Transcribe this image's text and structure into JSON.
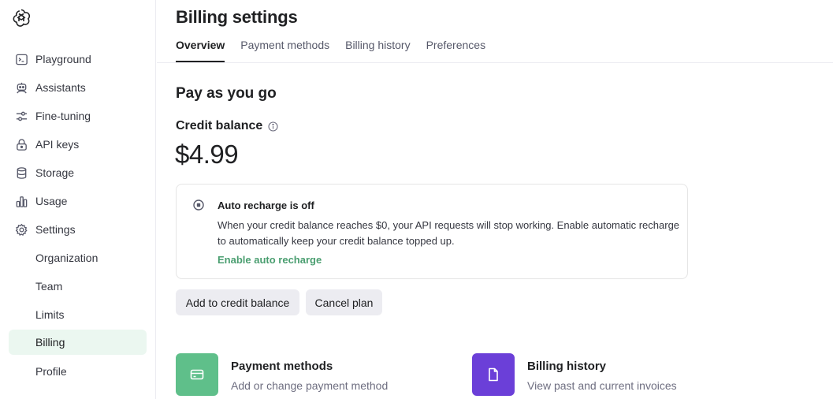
{
  "sidebar": {
    "logo": "openai-logo-icon",
    "items": [
      {
        "label": "Playground",
        "icon": "terminal-icon"
      },
      {
        "label": "Assistants",
        "icon": "robot-icon"
      },
      {
        "label": "Fine-tuning",
        "icon": "sliders-icon"
      },
      {
        "label": "API keys",
        "icon": "lock-icon"
      },
      {
        "label": "Storage",
        "icon": "database-icon"
      },
      {
        "label": "Usage",
        "icon": "bar-chart-icon"
      },
      {
        "label": "Settings",
        "icon": "gear-icon"
      }
    ],
    "settings_sub": [
      {
        "label": "Organization"
      },
      {
        "label": "Team"
      },
      {
        "label": "Limits"
      },
      {
        "label": "Billing",
        "active": true
      },
      {
        "label": "Profile"
      }
    ]
  },
  "header": {
    "title": "Billing settings",
    "tabs": [
      {
        "label": "Overview",
        "active": true
      },
      {
        "label": "Payment methods"
      },
      {
        "label": "Billing history"
      },
      {
        "label": "Preferences"
      }
    ]
  },
  "plan": {
    "title": "Pay as you go",
    "credit_label": "Credit balance",
    "balance": "$4.99"
  },
  "auto_recharge": {
    "title": "Auto recharge is off",
    "description": "When your credit balance reaches $0, your API requests will stop working. Enable automatic recharge to automatically keep your credit balance topped up.",
    "link": "Enable auto recharge"
  },
  "actions": {
    "add_credit": "Add to credit balance",
    "cancel_plan": "Cancel plan"
  },
  "tiles": {
    "payment_methods": {
      "title": "Payment methods",
      "subtitle": "Add or change payment method",
      "icon": "credit-card-icon",
      "color": "#5fbf8a"
    },
    "billing_history": {
      "title": "Billing history",
      "subtitle": "View past and current invoices",
      "icon": "document-icon",
      "color": "#6b3fd8"
    }
  },
  "colors": {
    "accent_green": "#4a9e70",
    "active_nav_bg": "#ebf7f0"
  }
}
